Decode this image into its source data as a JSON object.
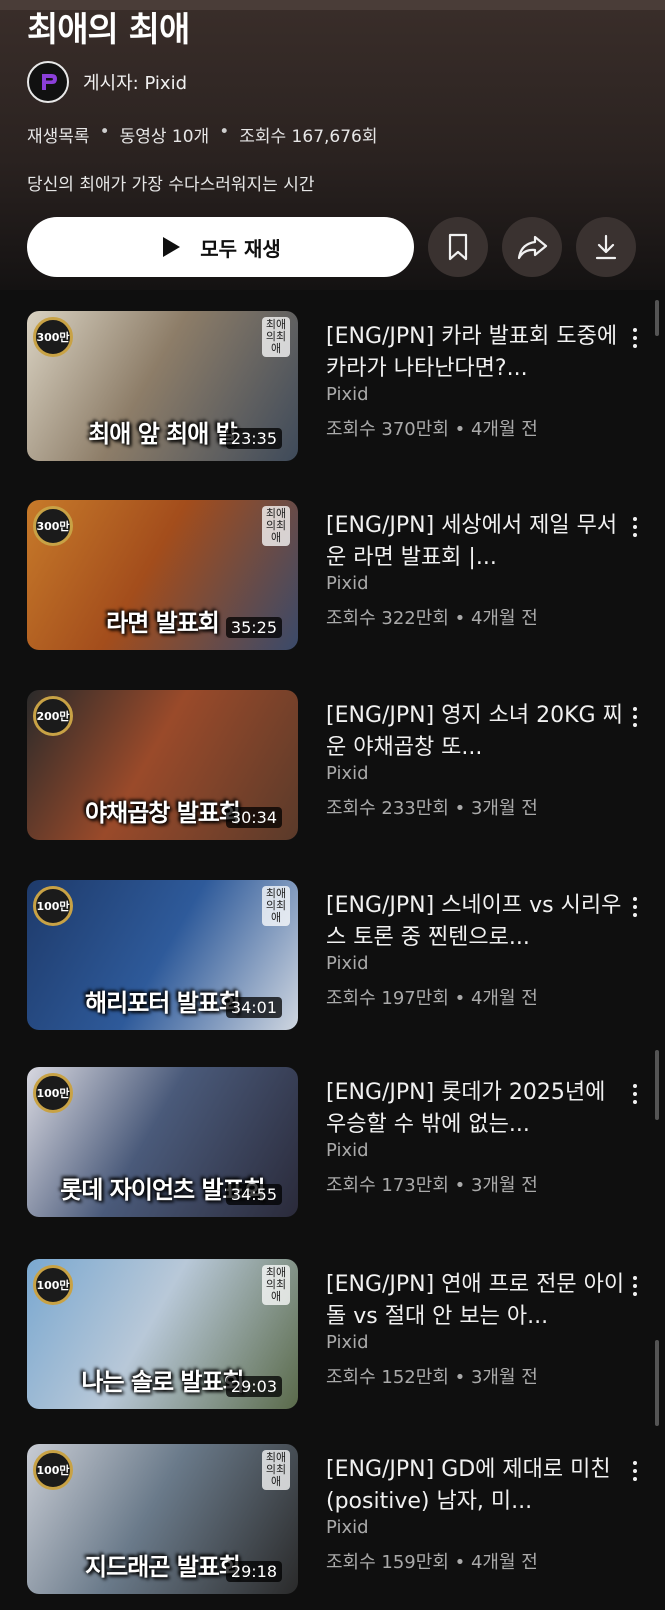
{
  "playlist": {
    "title": "최애의 최애",
    "owner": "게시자: Pixid",
    "meta": [
      "재생목록",
      "동영상 10개",
      "조회수 167,676회"
    ],
    "description": "당신의 최애가 가장 수다스러워지는 시간",
    "play_all_label": "모두 재생"
  },
  "actions": [
    "bookmark-icon",
    "share-icon",
    "download-icon"
  ],
  "videos": [
    {
      "title": "[ENG/JPN] 카라 발표회 도중에 카라가 나타난다면?...",
      "channel": "Pixid",
      "stats": "조회수 370만회 • 4개월 전",
      "duration": "23:35",
      "badge": "300만",
      "caption": "최애 앞 최애 발",
      "thumb_color": "#6a5a48"
    },
    {
      "title": "[ENG/JPN] 세상에서 제일 무서운 라면 발표회 |...",
      "channel": "Pixid",
      "stats": "조회수 322만회 • 4개월 전",
      "duration": "35:25",
      "badge": "300만",
      "caption": "라면 발표회",
      "thumb_color": "#b5641f"
    },
    {
      "title": "[ENG/JPN] 영지 소녀 20KG 찌운 야채곱창 또...",
      "channel": "Pixid",
      "stats": "조회수 233만회 • 3개월 전",
      "duration": "30:34",
      "badge": "200만",
      "caption": "야채곱창 발표회",
      "thumb_color": "#8a4a2c"
    },
    {
      "title": "[ENG/JPN] 스네이프 vs 시리우스 토론 중 찐텐으로...",
      "channel": "Pixid",
      "stats": "조회수 197만회 • 4개월 전",
      "duration": "34:01",
      "badge": "100만",
      "caption": "해리포터 발표회",
      "thumb_color": "#2c4a7a"
    },
    {
      "title": "[ENG/JPN] 롯데가 2025년에 우승할 수 밖에 없는...",
      "channel": "Pixid",
      "stats": "조회수 173만회 • 3개월 전",
      "duration": "34:55",
      "badge": "100만",
      "caption": "롯데 자이언츠 발표회",
      "thumb_color": "#3a4c6a"
    },
    {
      "title": "[ENG/JPN] 연애 프로 전문 아이돌 vs 절대 안 보는 아...",
      "channel": "Pixid",
      "stats": "조회수 152만회 • 3개월 전",
      "duration": "29:03",
      "badge": "100만",
      "caption": "나는 솔로 발표회",
      "thumb_color": "#4a6a3a"
    },
    {
      "title": "[ENG/JPN] GD에 제대로 미친(positive) 남자, 미...",
      "channel": "Pixid",
      "stats": "조회수 159만회 • 4개월 전",
      "duration": "29:18",
      "badge": "100만",
      "caption": "지드래곤 발표회",
      "thumb_color": "#5a6a7a"
    }
  ]
}
